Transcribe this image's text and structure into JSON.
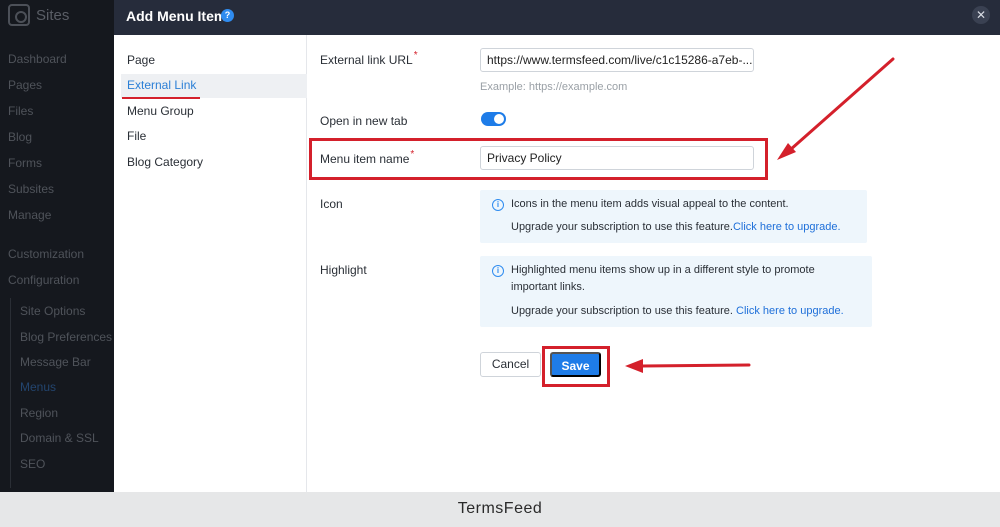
{
  "app": {
    "name": "Sites",
    "nav": [
      "Dashboard",
      "Pages",
      "Files",
      "Blog",
      "Forms",
      "Subsites",
      "Manage"
    ],
    "nav2": [
      "Customization",
      "Configuration"
    ],
    "sub": [
      "Site Options",
      "Blog Preferences",
      "Message Bar",
      "Menus",
      "Region",
      "Domain & SSL",
      "SEO"
    ]
  },
  "modal": {
    "title": "Add Menu Item",
    "help_icon": "help-circle-icon",
    "close_icon": "close-icon",
    "tabs": [
      "Page",
      "External Link",
      "Menu Group",
      "File",
      "Blog Category"
    ],
    "active_tab": "External Link"
  },
  "form": {
    "url_label": "External link URL",
    "url_value": "https://www.termsfeed.com/live/c1c15286-a7eb-...",
    "url_hint": "Example: https://example.com",
    "newtab_label": "Open in new tab",
    "newtab_on": true,
    "name_label": "Menu item name",
    "name_value": "Privacy Policy",
    "icon_label": "Icon",
    "icon_info": "Icons in the menu item adds visual appeal to the content.",
    "icon_upgrade": "Upgrade your subscription to use this feature.",
    "icon_link": "Click here to upgrade.",
    "highlight_label": "Highlight",
    "highlight_info_1": "Highlighted menu items show up in a different style to promote",
    "highlight_info_2": "important links.",
    "highlight_upgrade": "Upgrade your subscription to use this feature.",
    "highlight_link": "Click here to upgrade.",
    "required_mark": "*",
    "cancel": "Cancel",
    "save": "Save"
  },
  "colors": {
    "accent": "#1e7ce8",
    "annotation": "#d4202b"
  },
  "footer": "TermsFeed"
}
